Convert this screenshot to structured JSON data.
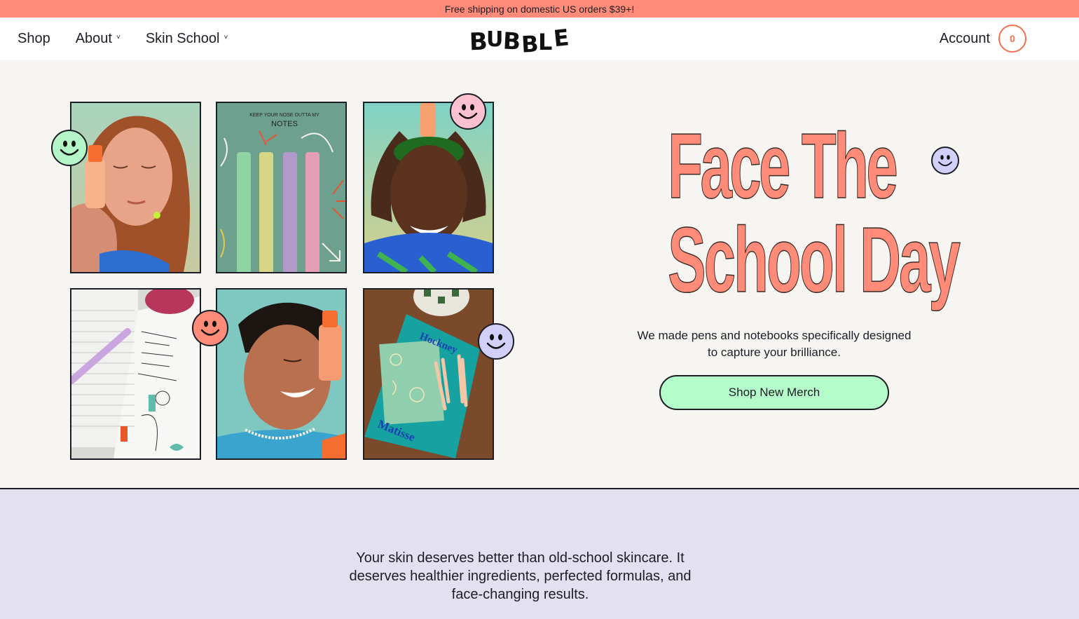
{
  "announcement": "Free shipping on domestic US orders $39+!",
  "nav": {
    "items": [
      {
        "label": "Shop",
        "has_dropdown": false
      },
      {
        "label": "About",
        "has_dropdown": true
      },
      {
        "label": "Skin School",
        "has_dropdown": true
      }
    ],
    "logo": "BUBBLE",
    "account_label": "Account",
    "cart_count": "0",
    "chevron_glyph": "˅"
  },
  "hero": {
    "headline_line1": "Face The",
    "headline_line2": "School Day",
    "subtitle": "We made pens and notebooks specifically designed to capture your brilliance.",
    "cta_label": "Shop New Merch",
    "tiles": [
      {
        "name": "woman-with-serum-photo",
        "caption": ""
      },
      {
        "name": "pens-notes-photo",
        "caption_small": "KEEP YOUR NOSE OUTTA MY",
        "caption_big": "NOTES"
      },
      {
        "name": "man-with-bottle-on-head-photo",
        "caption": ""
      },
      {
        "name": "notebook-doodles-photo",
        "caption": ""
      },
      {
        "name": "smiling-man-with-bottle-photo",
        "caption": ""
      },
      {
        "name": "notebook-and-pens-on-desk-photo",
        "book_top": "Hockney",
        "book_bottom": "Matisse"
      }
    ]
  },
  "about": {
    "text": "Your skin deserves better than old-school skincare. It deserves healthier ingredients, perfected formulas, and face-changing results."
  },
  "colors": {
    "accent_coral": "#ff8b78",
    "mint": "#b4fcc9",
    "lavender_section": "#e3e1ef",
    "cart_orange": "#f0714e",
    "smiley_green": "#b4f5c8",
    "smiley_pink": "#ffc0cf",
    "smiley_coral": "#ff8b78",
    "smiley_lavender": "#d3cffb"
  }
}
